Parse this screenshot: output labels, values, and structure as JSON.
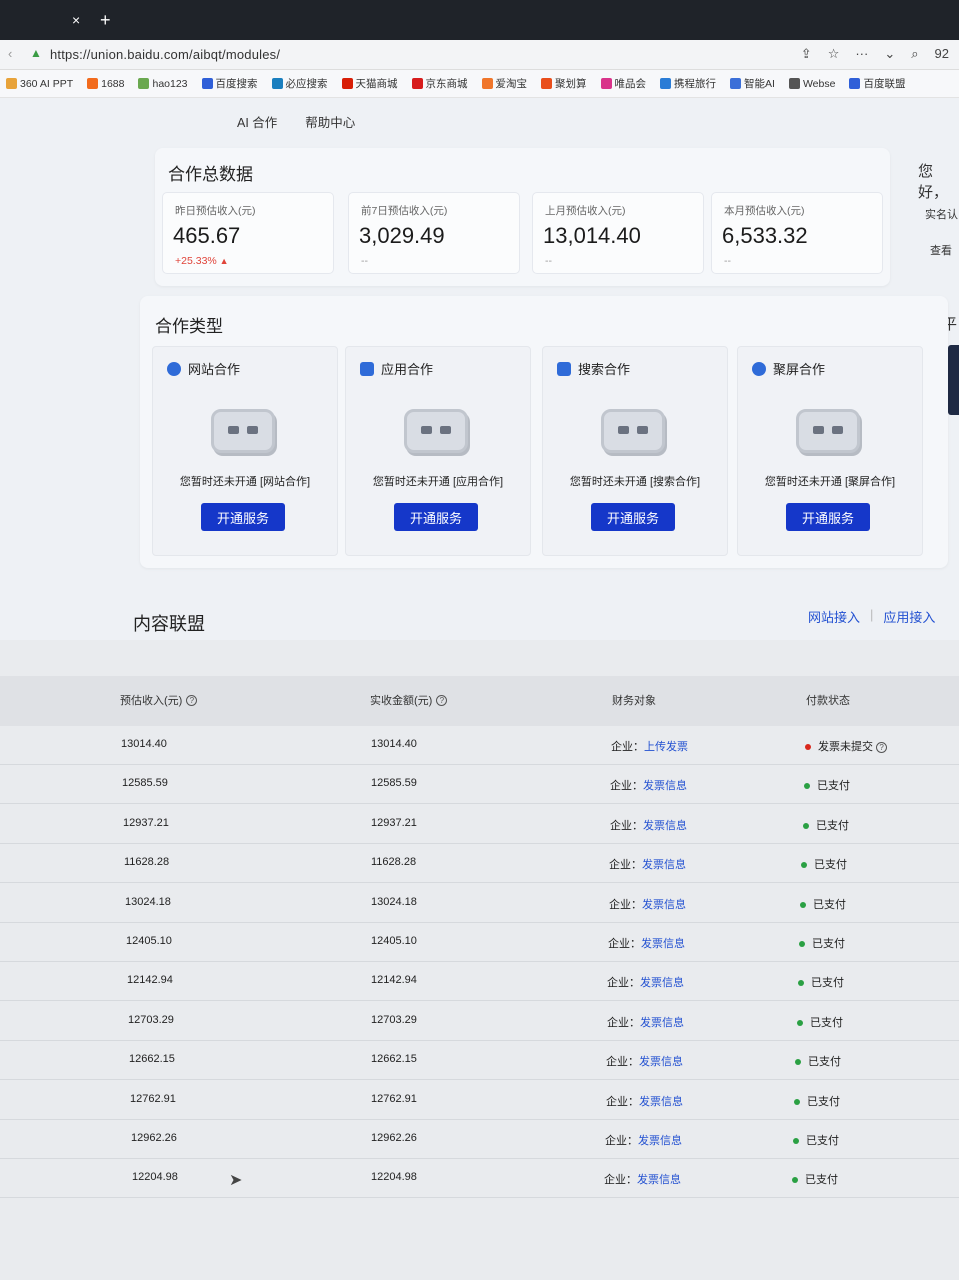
{
  "browser": {
    "tab_close": "×",
    "tab_new": "+",
    "url": "https://union.baidu.com/aibqt/modules/",
    "tools_right": "92",
    "bookmarks": [
      {
        "label": "360 AI PPT",
        "color": "#e8a33a"
      },
      {
        "label": "1688",
        "color": "#f26b1d"
      },
      {
        "label": "hao123",
        "color": "#6aa84f"
      },
      {
        "label": "百度搜索",
        "color": "#2f5fd8"
      },
      {
        "label": "必应搜索",
        "color": "#1a7fbf"
      },
      {
        "label": "天猫商城",
        "color": "#d81e06"
      },
      {
        "label": "京东商城",
        "color": "#d71c1c"
      },
      {
        "label": "爱淘宝",
        "color": "#f0762b"
      },
      {
        "label": "聚划算",
        "color": "#e94e1b"
      },
      {
        "label": "唯品会",
        "color": "#d9338a"
      },
      {
        "label": "携程旅行",
        "color": "#2a7cd6"
      },
      {
        "label": "智能AI",
        "color": "#3b6fd8"
      },
      {
        "label": "Webse",
        "color": "#555555"
      },
      {
        "label": "百度联盟",
        "color": "#2f5fd8"
      }
    ]
  },
  "nav": {
    "items": [
      "AI 合作",
      "帮助中心"
    ]
  },
  "stats": {
    "title": "合作总数据",
    "cards": [
      {
        "label": "昨日预估收入(元)",
        "value": "465.67",
        "sub": "+25.33%",
        "trend": "up"
      },
      {
        "label": "前7日预估收入(元)",
        "value": "3,029.49",
        "sub": "--",
        "trend": "none"
      },
      {
        "label": "上月预估收入(元)",
        "value": "13,014.40",
        "sub": "--",
        "trend": "none"
      },
      {
        "label": "本月预估收入(元)",
        "value": "6,533.32",
        "sub": "--",
        "trend": "none"
      }
    ]
  },
  "sidebar": {
    "greeting": "您好，",
    "line1": "实名认",
    "line2": "查看",
    "line3": "平"
  },
  "types": {
    "title": "合作类型",
    "cards": [
      {
        "name": "网站合作",
        "message": "您暂时还未开通 [网站合作]",
        "button": "开通服务",
        "icon": "globe-icon",
        "color": "#2f6bd8"
      },
      {
        "name": "应用合作",
        "message": "您暂时还未开通 [应用合作]",
        "button": "开通服务",
        "icon": "app-grid-icon",
        "color": "#2f6bd8"
      },
      {
        "name": "搜索合作",
        "message": "您暂时还未开通 [搜索合作]",
        "button": "开通服务",
        "icon": "search-box-icon",
        "color": "#2f6bd8"
      },
      {
        "name": "聚屏合作",
        "message": "您暂时还未开通 [聚屏合作]",
        "button": "开通服务",
        "icon": "screen-icon",
        "color": "#2f6bd8"
      }
    ]
  },
  "content": {
    "title": "内容联盟",
    "link_site": "网站接入",
    "link_app": "应用接入"
  },
  "table": {
    "headers": [
      "预估收入(元)",
      "实收金额(元)",
      "财务对象",
      "付款状态"
    ],
    "rows": [
      {
        "estimated": "13014.40",
        "received": "13014.40",
        "entity": "企业：",
        "action": "上传发票",
        "status": "发票未提交",
        "status_color": "#d9281c",
        "help": true
      },
      {
        "estimated": "12585.59",
        "received": "12585.59",
        "entity": "企业：",
        "action": "发票信息",
        "status": "已支付",
        "status_color": "#2aa043",
        "help": false
      },
      {
        "estimated": "12937.21",
        "received": "12937.21",
        "entity": "企业：",
        "action": "发票信息",
        "status": "已支付",
        "status_color": "#2aa043",
        "help": false
      },
      {
        "estimated": "11628.28",
        "received": "11628.28",
        "entity": "企业：",
        "action": "发票信息",
        "status": "已支付",
        "status_color": "#2aa043",
        "help": false
      },
      {
        "estimated": "13024.18",
        "received": "13024.18",
        "entity": "企业：",
        "action": "发票信息",
        "status": "已支付",
        "status_color": "#2aa043",
        "help": false
      },
      {
        "estimated": "12405.10",
        "received": "12405.10",
        "entity": "企业：",
        "action": "发票信息",
        "status": "已支付",
        "status_color": "#2aa043",
        "help": false
      },
      {
        "estimated": "12142.94",
        "received": "12142.94",
        "entity": "企业：",
        "action": "发票信息",
        "status": "已支付",
        "status_color": "#2aa043",
        "help": false
      },
      {
        "estimated": "12703.29",
        "received": "12703.29",
        "entity": "企业：",
        "action": "发票信息",
        "status": "已支付",
        "status_color": "#2aa043",
        "help": false
      },
      {
        "estimated": "12662.15",
        "received": "12662.15",
        "entity": "企业：",
        "action": "发票信息",
        "status": "已支付",
        "status_color": "#2aa043",
        "help": false
      },
      {
        "estimated": "12762.91",
        "received": "12762.91",
        "entity": "企业：",
        "action": "发票信息",
        "status": "已支付",
        "status_color": "#2aa043",
        "help": false
      },
      {
        "estimated": "12962.26",
        "received": "12962.26",
        "entity": "企业：",
        "action": "发票信息",
        "status": "已支付",
        "status_color": "#2aa043",
        "help": false
      },
      {
        "estimated": "12204.98",
        "received": "12204.98",
        "entity": "企业：",
        "action": "发票信息",
        "status": "已支付",
        "status_color": "#2aa043",
        "help": false
      }
    ]
  }
}
